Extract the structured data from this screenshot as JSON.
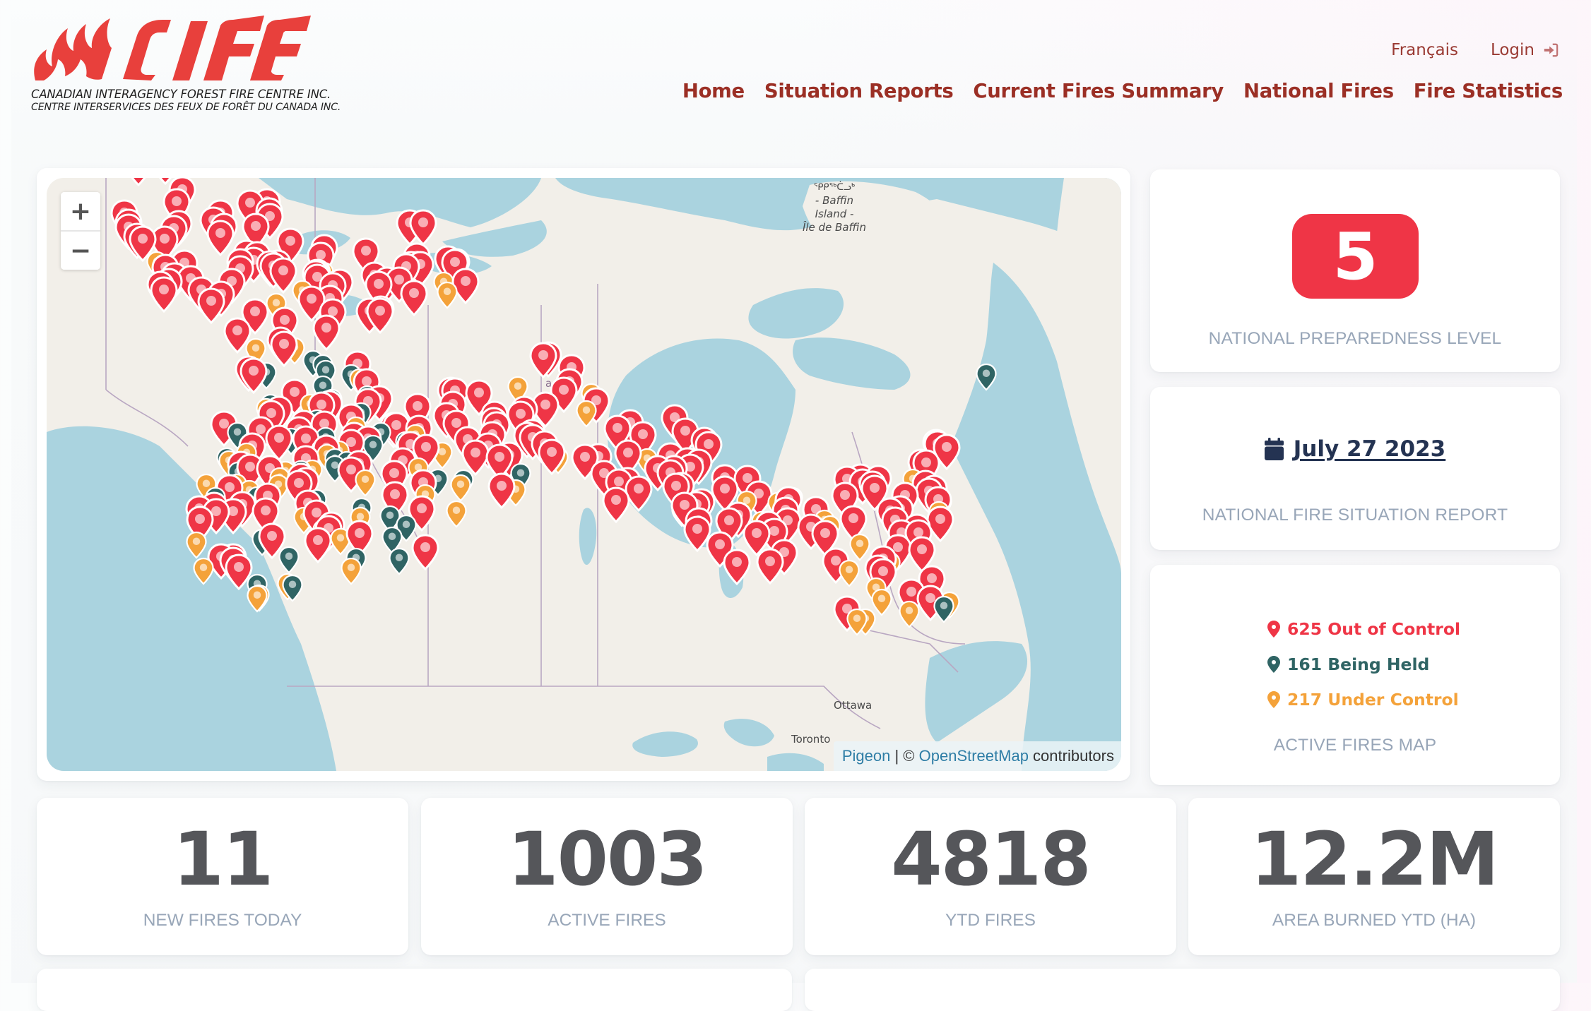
{
  "brand": {
    "logo_text": "CIFFC",
    "name_en": "CANADIAN INTERAGENCY FOREST FIRE CENTRE INC.",
    "name_fr": "CENTRE INTERSERVICES DES FEUX DE FORÊT DU CANADA INC.",
    "color": "#e8403c"
  },
  "header": {
    "language_link": "Français",
    "login_label": "Login",
    "login_icon": "sign-in-icon",
    "nav": [
      {
        "label": "Home"
      },
      {
        "label": "Situation Reports"
      },
      {
        "label": "Current Fires Summary"
      },
      {
        "label": "National Fires"
      },
      {
        "label": "Fire Statistics"
      }
    ],
    "nav_color": "#9b2f25"
  },
  "map": {
    "zoom_in": "+",
    "zoom_out": "−",
    "labels": {
      "baffin_syllabics": "ᕿᑭᖅᑖᓗᒃ",
      "baffin_1": "- Baffin",
      "baffin_2": "Island -",
      "baffin_3": "Île de Baffin",
      "canada_fragment": "ada",
      "ottawa": "Ottawa",
      "toronto": "Toronto"
    },
    "attribution": {
      "pigeon": "Pigeon",
      "separator": " | © ",
      "osm": "OpenStreetMap",
      "contributors": " contributors"
    },
    "marker_colors": {
      "out_of_control": "#ef3546",
      "being_held": "#2f6464",
      "under_control": "#f4a23a"
    }
  },
  "preparedness": {
    "level": "5",
    "caption": "NATIONAL PREPAREDNESS LEVEL",
    "badge_color": "#ef3546"
  },
  "situation_report": {
    "date": "July 27 2023",
    "icon": "calendar-icon",
    "caption": "NATIONAL FIRE SITUATION REPORT"
  },
  "active_fires_map": {
    "statuses": [
      {
        "text": "625 Out of Control",
        "count": 625,
        "label": "Out of Control",
        "color": "#ef3546"
      },
      {
        "text": "161 Being Held",
        "count": 161,
        "label": "Being Held",
        "color": "#2f6464"
      },
      {
        "text": "217 Under Control",
        "count": 217,
        "label": "Under Control",
        "color": "#f4a23a"
      }
    ],
    "caption": "ACTIVE FIRES MAP"
  },
  "stats": [
    {
      "value": "11",
      "label": "NEW FIRES TODAY"
    },
    {
      "value": "1003",
      "label": "ACTIVE FIRES"
    },
    {
      "value": "4818",
      "label": "YTD FIRES"
    },
    {
      "value": "12.2M",
      "label": "AREA BURNED YTD (HA)"
    }
  ]
}
